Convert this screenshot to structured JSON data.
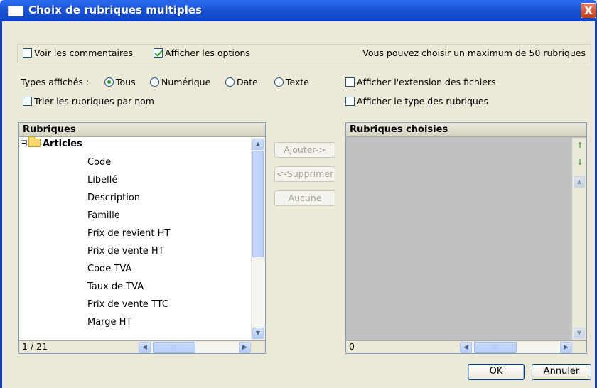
{
  "window": {
    "title": "Choix de rubriques multiples",
    "close_glyph": "X"
  },
  "options": {
    "voir_commentaires": {
      "label": "Voir les commentaires",
      "checked": false
    },
    "afficher_options": {
      "label": "Afficher les options",
      "checked": true
    },
    "max_info": "Vous pouvez choisir un maximum de 50 rubriques"
  },
  "types": {
    "label": "Types affichés :",
    "options": [
      {
        "label": "Tous",
        "selected": true
      },
      {
        "label": "Numérique",
        "selected": false
      },
      {
        "label": "Date",
        "selected": false
      },
      {
        "label": "Texte",
        "selected": false
      }
    ]
  },
  "checks": {
    "trier": {
      "label": "Trier les rubriques par nom",
      "checked": false
    },
    "extension": {
      "label": "Afficher l'extension des fichiers",
      "checked": false
    },
    "type_rubriques": {
      "label": "Afficher le type des rubriques",
      "checked": false
    }
  },
  "rubriques": {
    "header": "Rubriques",
    "root": "Articles",
    "items": [
      "Code",
      "Libellé",
      "Description",
      "Famille",
      "Prix de revient HT",
      "Prix de vente HT",
      "Code TVA",
      "Taux de TVA",
      "Prix de vente TTC",
      "Marge HT"
    ],
    "status": "1 / 21"
  },
  "actions": {
    "ajouter": "Ajouter->",
    "supprimer": "<-Supprimer",
    "aucune": "Aucune"
  },
  "choisies": {
    "header": "Rubriques choisies",
    "status": "0"
  },
  "buttons": {
    "ok": "OK",
    "annuler": "Annuler"
  },
  "colors": {
    "titlebar": "#0e43c4",
    "dialog_bg": "#ece9d8",
    "selected_list_bg": "#c0c0c0",
    "check_accent": "#21a121"
  },
  "icons": {
    "close": "close-icon",
    "folder": "folder-icon",
    "collapse": "collapse-icon",
    "move_up": "move-up-icon",
    "move_down": "move-down-icon"
  }
}
